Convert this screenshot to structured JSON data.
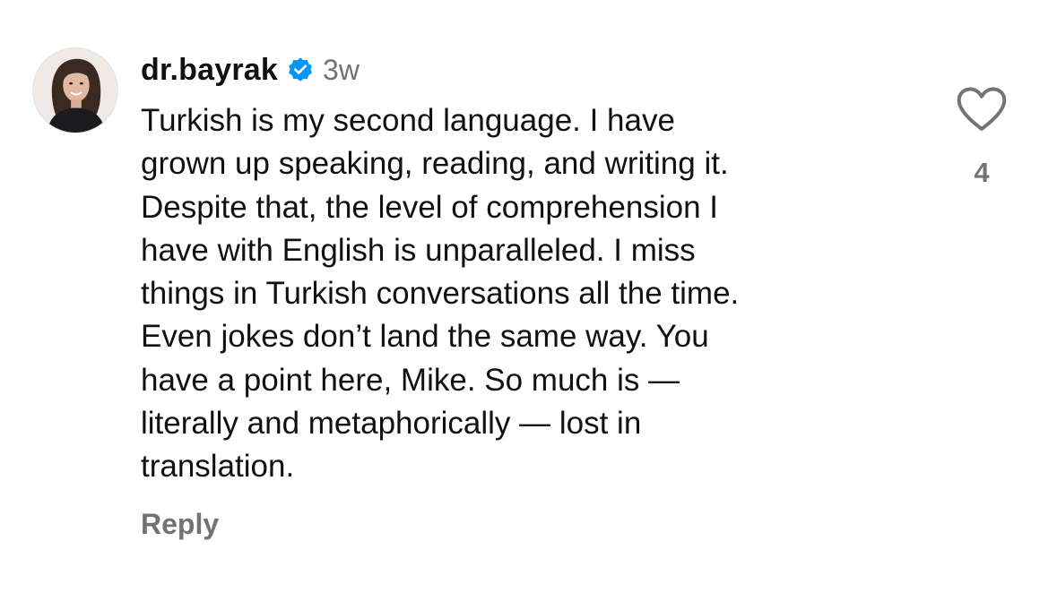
{
  "comment": {
    "username": "dr.bayrak",
    "verified_icon": "verified-badge-icon",
    "timestamp": "3w",
    "body_lines": [
      "Turkish is my second language. I have",
      "grown up speaking, reading, and writing it.",
      "Despite that, the level of comprehension I",
      "have with English is unparalleled. I miss",
      "things in Turkish conversations all the time.",
      "Even jokes don’t land the same way. You",
      "have a point here, Mike. So much is —",
      "literally and metaphorically — lost in",
      "translation."
    ],
    "reply_label": "Reply",
    "like_icon": "heart-outline-icon",
    "like_count": "4"
  },
  "colors": {
    "text_primary": "#111111",
    "text_secondary": "#737373",
    "verified_blue": "#0095f6",
    "background": "#ffffff"
  }
}
